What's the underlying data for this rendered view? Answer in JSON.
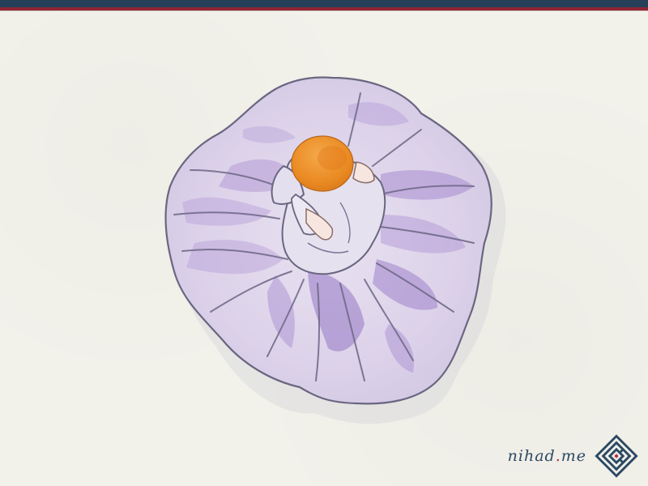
{
  "watermark": {
    "name": "nihad",
    "dot": ".",
    "suffix": "me"
  },
  "colors": {
    "navy": "#27405a",
    "crimson": "#8e2534",
    "paper": "#f2f1ea",
    "skirt_light": "#ddd2ea",
    "skirt_mid": "#b59bd4",
    "skirt_dark": "#8f72b9",
    "outline": "#5f5d74",
    "hat": "#f19a2c"
  },
  "icons": {
    "logo": "kufic-square-logo-icon"
  }
}
